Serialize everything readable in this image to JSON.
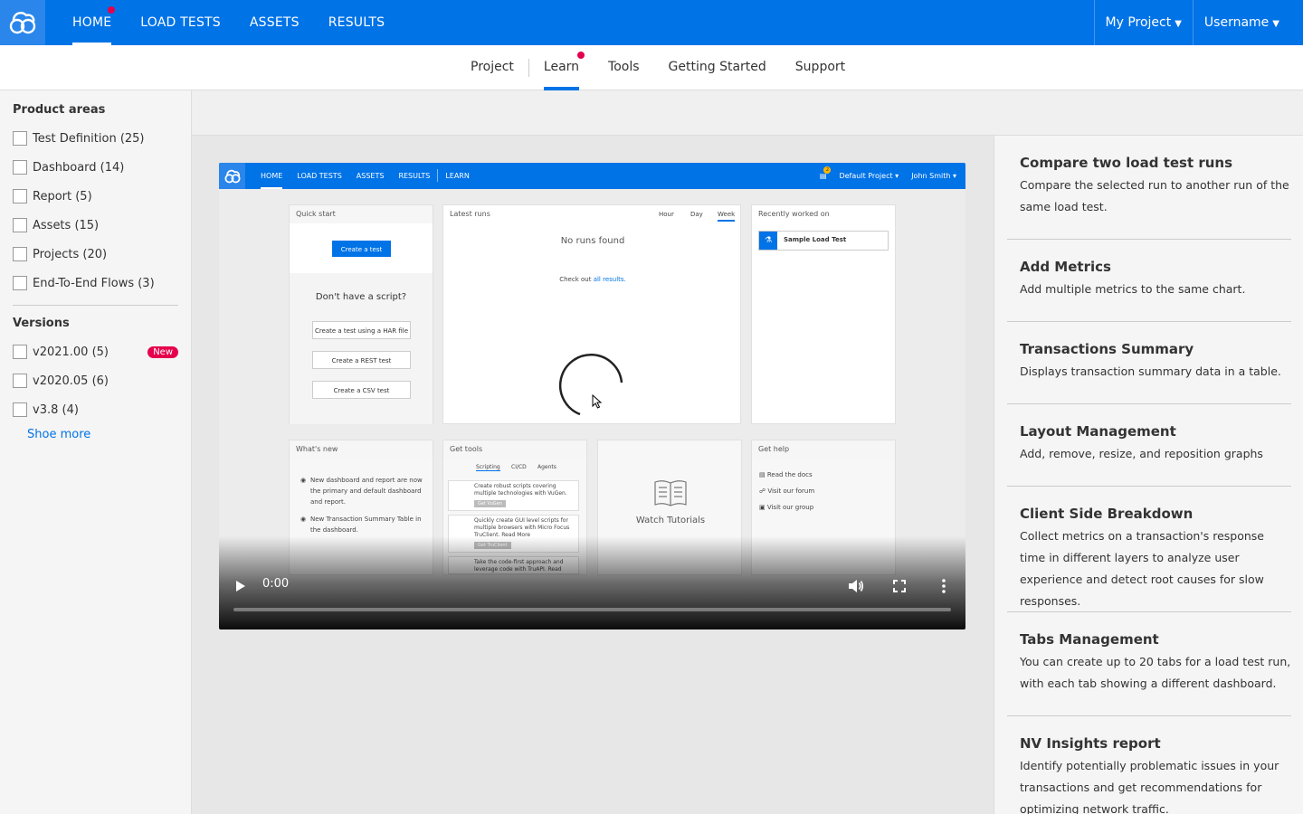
{
  "topbar": {
    "nav": [
      "HOME",
      "LOAD TESTS",
      "ASSETS",
      "RESULTS"
    ],
    "project_label": "My Project",
    "user_label": "Username"
  },
  "subnav": {
    "tabs": [
      "Project",
      "Learn",
      "Tools",
      "Getting Started",
      "Support"
    ]
  },
  "sidebar": {
    "product_areas_title": "Product areas",
    "product_areas": [
      "Test Definition (25)",
      "Dashboard (14)",
      "Report (5)",
      "Assets (15)",
      "Projects (20)",
      "End-To-End Flows (3)"
    ],
    "versions_title": "Versions",
    "versions": [
      "v2021.00 (5)",
      "v2020.05 (6)",
      "v3.8 (4)"
    ],
    "new_badge": "New",
    "show_more": "Shoe more"
  },
  "video": {
    "inner_nav": [
      "HOME",
      "LOAD TESTS",
      "ASSETS",
      "RESULTS",
      "LEARN"
    ],
    "inner_notif_count": "2",
    "inner_project": "Default Project",
    "inner_user": "John Smith",
    "quick_start_title": "Quick start",
    "create_test": "Create a test",
    "no_script": "Don't have a script?",
    "har_btn": "Create a test using a HAR file",
    "rest_btn": "Create a REST test",
    "csv_btn": "Create a CSV test",
    "latest_runs_title": "Latest runs",
    "range_hour": "Hour",
    "range_day": "Day",
    "range_week": "Week",
    "no_runs": "No runs found",
    "check_out": "Check out",
    "all_results": "all results.",
    "recent_title": "Recently worked on",
    "recent_item": "Sample Load Test",
    "whats_new_title": "What's new",
    "whats_new_1": "New dashboard and report are now the primary and default dashboard and report.",
    "whats_new_2": "New Transaction Summary Table in the dashboard.",
    "get_tools_title": "Get tools",
    "tools_tabs": [
      "Scripting",
      "CI/CD",
      "Agents"
    ],
    "tool_1": "Create robust scripts covering multiple technologies with VuGen.",
    "tool_1_btn": "Get VuGen",
    "tool_2": "Quickly create GUI level scripts for multiple browsers with Micro Focus TruClient. Read More",
    "tool_2_btn": "Get TruClient",
    "tool_3": "Take the code-first approach and leverage code with TruAPI. Read",
    "watch_tutorials": "Watch Tutorials",
    "get_help_title": "Get help",
    "help_links": [
      "Read the docs",
      "Visit our forum",
      "Visit our group"
    ],
    "time": "0:00",
    "progress": 0
  },
  "learn_items": [
    {
      "title": "Compare two load test runs",
      "desc": "Compare the selected run to another run of the same load test."
    },
    {
      "title": "Add Metrics",
      "desc": "Add multiple metrics to the same chart."
    },
    {
      "title": "Transactions Summary",
      "desc": "Displays transaction summary data in a table."
    },
    {
      "title": "Layout Management",
      "desc": "Add, remove, resize, and reposition graphs"
    },
    {
      "title": "Client Side Breakdown",
      "desc": "Collect metrics on a transaction's response time in different layers to analyze user experience and detect root causes for slow responses."
    },
    {
      "title": "Tabs Management",
      "desc": "You can create up to 20 tabs for a load test run, with each tab showing a different dashboard."
    },
    {
      "title": "NV Insights report",
      "desc": "Identify potentially problematic issues in your transactions and get recommendations for optimizing network traffic."
    }
  ],
  "colors": {
    "brand": "#0073e7",
    "notification": "#e5004c",
    "badge": "#e5004c"
  }
}
